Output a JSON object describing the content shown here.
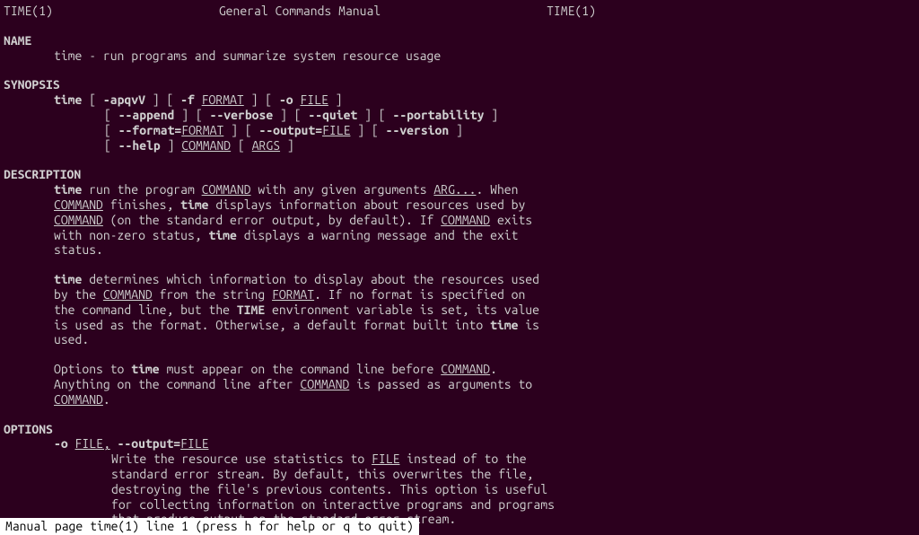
{
  "header": {
    "left": "TIME(1)",
    "center": "General Commands Manual",
    "right": "TIME(1)"
  },
  "sections": {
    "name": {
      "header": "NAME",
      "content": "time - run programs and summarize system resource usage"
    },
    "synopsis": {
      "header": "SYNOPSIS",
      "cmd": "time",
      "line1": {
        "opts": "-apqvV",
        "f": "-f",
        "format": "FORMAT",
        "o": "-o",
        "file": "FILE"
      },
      "line2": {
        "append": "--append",
        "verbose": "--verbose",
        "quiet": "--quiet",
        "portability": "--portability"
      },
      "line3": {
        "format": "--format=",
        "formatval": "FORMAT",
        "output": "--output=",
        "outputval": "FILE",
        "version": "--version"
      },
      "line4": {
        "help": "--help",
        "command": "COMMAND",
        "args": "ARGS"
      }
    },
    "description": {
      "header": "DESCRIPTION",
      "p1": {
        "time1": "time",
        "t1": " run the program ",
        "command1": "COMMAND",
        "t2": " with any given arguments ",
        "arg": "ARG...",
        "t3": ".  When",
        "command2": "COMMAND",
        "t4": " finishes, ",
        "time2": "time",
        "t5": " displays information about resources used by",
        "command3": "COMMAND",
        "t6": " (on the standard error output, by default).  If ",
        "command4": "COMMAND",
        "t7": " exits",
        "t8": "with non-zero status, ",
        "time3": "time",
        "t9": " displays a warning message and the exit",
        "t10": "status."
      },
      "p2": {
        "time1": "time",
        "t1": " determines which information to display about the resources used",
        "t2": "by the ",
        "command1": "COMMAND",
        "t3": " from the string ",
        "format1": "FORMAT",
        "t4": ".  If no format is specified on",
        "t5": "the command line, but the ",
        "timevar": "TIME",
        "t6": " environment variable is set, its value",
        "t7": "is used as the format.  Otherwise, a default format built into ",
        "time2": "time",
        "t8": " is",
        "t9": "used."
      },
      "p3": {
        "t1": "Options to ",
        "time1": "time",
        "t2": " must appear on the command line before ",
        "command1": "COMMAND",
        "t3": ".",
        "t4": "Anything on the command line after ",
        "command2": "COMMAND",
        "t5": " is passed as arguments to",
        "command3": "COMMAND",
        "t6": "."
      }
    },
    "options": {
      "header": "OPTIONS",
      "opt1": {
        "flag": "-o",
        "file1": "FILE,",
        "longflag": "--output=",
        "file2": "FILE",
        "desc1": "Write the resource use statistics to ",
        "fileul": "FILE",
        "desc2": " instead of to the",
        "desc3": "standard error stream.  By default, this overwrites the file,",
        "desc4": "destroying the file's previous contents.  This option is useful",
        "desc5": "for collecting information on interactive programs and programs",
        "desc6": "that produce output on the standard error stream."
      }
    }
  },
  "statusbar": "Manual page time(1) line 1 (press h for help or q to quit)"
}
